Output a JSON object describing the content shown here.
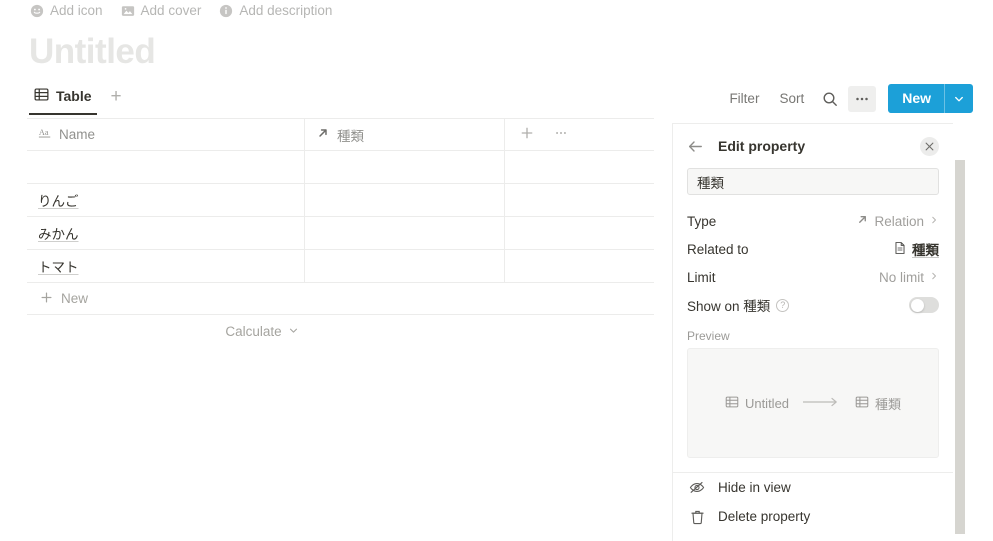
{
  "page": {
    "add_icon": "Add icon",
    "add_cover": "Add cover",
    "add_description": "Add description",
    "title": "Untitled"
  },
  "view_tabs": {
    "table_label": "Table",
    "add_view_label": "+"
  },
  "toolbar": {
    "filter_label": "Filter",
    "sort_label": "Sort",
    "search_icon": "search-icon",
    "more_icon": "ellipsis-icon",
    "new_label": "New",
    "new_caret_icon": "chevron-down-icon",
    "accent_color": "#1ca0d8"
  },
  "table": {
    "columns": [
      {
        "label": "Name",
        "icon": "text-aa-icon"
      },
      {
        "label": "種類",
        "icon": "relation-arrow-icon"
      }
    ],
    "add_column_icon": "plus-icon",
    "column_more_icon": "ellipsis-icon",
    "rows": [
      {
        "name": "",
        "kind": ""
      },
      {
        "name": "りんご",
        "kind": ""
      },
      {
        "name": "みかん",
        "kind": ""
      },
      {
        "name": "トマト",
        "kind": ""
      }
    ],
    "new_row_label": "New",
    "calculate_label": "Calculate"
  },
  "panel": {
    "back_icon": "arrow-left-icon",
    "title": "Edit property",
    "close_icon": "close-icon",
    "name_value": "種類",
    "properties": [
      {
        "label": "Type",
        "value": "Relation",
        "icon": "relation-arrow-icon"
      },
      {
        "label": "Related to",
        "value": "種類",
        "icon": "page-doc-icon"
      },
      {
        "label": "Limit",
        "value": "No limit",
        "icon": ""
      }
    ],
    "show_on_label": "Show on 種類",
    "show_on_help_icon": "question-mark-icon",
    "show_on_enabled": false,
    "preview_label": "Preview",
    "preview_source": "Untitled",
    "preview_target": "種類",
    "preview_arrow_icon": "arrow-right-icon",
    "preview_db_icon": "table-grid-icon",
    "actions": [
      {
        "label": "Hide in view",
        "icon": "eye-off-icon"
      },
      {
        "label": "Delete property",
        "icon": "trash-icon"
      }
    ]
  },
  "scrollbar": {
    "name": "vertical-scrollbar"
  }
}
